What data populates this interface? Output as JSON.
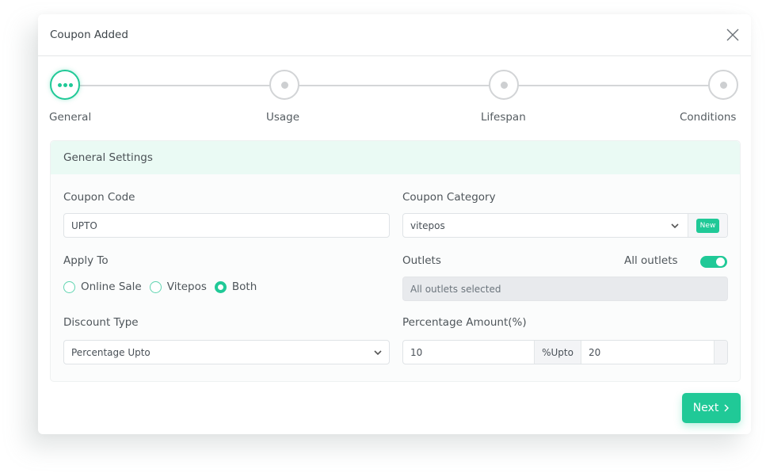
{
  "modal": {
    "title": "Coupon Added",
    "close_icon": "close-icon"
  },
  "stepper": {
    "steps": [
      {
        "label": "General",
        "state": "active"
      },
      {
        "label": "Usage",
        "state": "pending"
      },
      {
        "label": "Lifespan",
        "state": "pending"
      },
      {
        "label": "Conditions",
        "state": "pending"
      }
    ]
  },
  "general": {
    "header": "General Settings",
    "coupon_code": {
      "label": "Coupon Code",
      "value": "UPTO"
    },
    "coupon_category": {
      "label": "Coupon Category",
      "value": "vitepos",
      "new_label": "New"
    },
    "apply_to": {
      "label": "Apply To",
      "options": [
        {
          "label": "Online Sale",
          "checked": false
        },
        {
          "label": "Vitepos",
          "checked": false
        },
        {
          "label": "Both",
          "checked": true
        }
      ]
    },
    "outlets": {
      "label": "Outlets",
      "toggle_label": "All outlets",
      "toggle_on": true,
      "placeholder": "All outlets selected"
    },
    "discount_type": {
      "label": "Discount Type",
      "value": "Percentage Upto"
    },
    "percentage_amount": {
      "label": "Percentage Amount(%)",
      "value": "10",
      "addon": "%Upto",
      "upto_value": "20"
    }
  },
  "footer": {
    "next_label": "Next",
    "next_icon": "chevron-right-icon"
  },
  "colors": {
    "accent": "#20c997",
    "header_bg": "#eafaf4"
  }
}
